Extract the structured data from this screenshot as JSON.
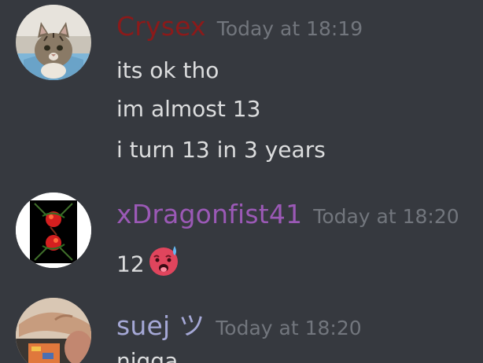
{
  "messages": [
    {
      "author": "Crysex",
      "author_color": "#8b1a1a",
      "timestamp": "Today at 18:19",
      "lines": [
        "its ok tho",
        "im almost 13",
        "i turn 13 in 3 years"
      ]
    },
    {
      "author": "xDragonfist41",
      "author_color": "#9b59b6",
      "timestamp": "Today at 18:20",
      "lines": [
        "12"
      ],
      "emoji": "hot-face-sweat-emoji"
    },
    {
      "author": "suej ツ",
      "author_color": "#a5a8d6",
      "timestamp": "Today at 18:20",
      "lines": [
        "nigga"
      ]
    }
  ]
}
